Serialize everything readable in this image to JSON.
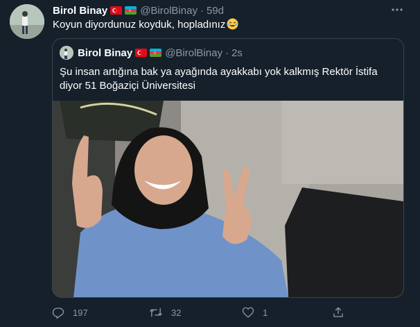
{
  "tweet": {
    "author_name": "Birol Binay",
    "handle": "@BirolBinay",
    "separator": "·",
    "time": "59d",
    "text": "Koyun diyordunuz koyduk, hopladınız",
    "emoji": "rolling-on-floor-laughing-emoji"
  },
  "quoted_tweet": {
    "author_name": "Birol Binay",
    "handle": "@BirolBinay",
    "separator": "·",
    "time": "2s",
    "text": "Şu insan artığına bak ya ayağında ayakkabı yok kalkmış Rektör İstifa diyor 51 Boğaziçi Üniversitesi",
    "image": "photo-woman-headscarf-victory-signs"
  },
  "actions": {
    "reply_count": "197",
    "retweet_count": "32",
    "like_count": "1",
    "share_count": ""
  },
  "colors": {
    "background": "#15202b",
    "secondary_text": "#8899a6",
    "border": "#38444d"
  },
  "icons": [
    "more-icon",
    "turkey-flag-icon",
    "azerbaijan-flag-icon",
    "reply-icon",
    "retweet-icon",
    "like-icon",
    "share-icon"
  ]
}
